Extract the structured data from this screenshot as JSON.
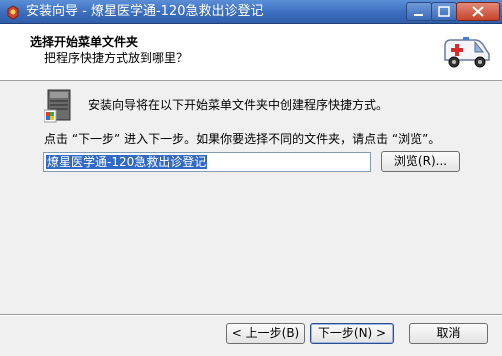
{
  "window": {
    "title": "安装向导 - 燎星医学通-120急救出诊登记"
  },
  "header": {
    "title": "选择开始菜单文件夹",
    "subtitle": "把程序快捷方式放到哪里？"
  },
  "content": {
    "intro": "安装向导将在以下开始菜单文件夹中创建程序快捷方式。",
    "instruction": "点击 “下一步” 进入下一步。如果你要选择不同的文件夹，请点击 “浏览”。",
    "folder_value": "燎星医学通-120急救出诊登记",
    "browse_label": "浏览(R)..."
  },
  "footer": {
    "back_label": "< 上一步(B)",
    "next_label": "下一步(N) >",
    "cancel_label": "取消"
  },
  "colors": {
    "titlebar": "#3b6dbf",
    "selection": "#3169c6"
  }
}
